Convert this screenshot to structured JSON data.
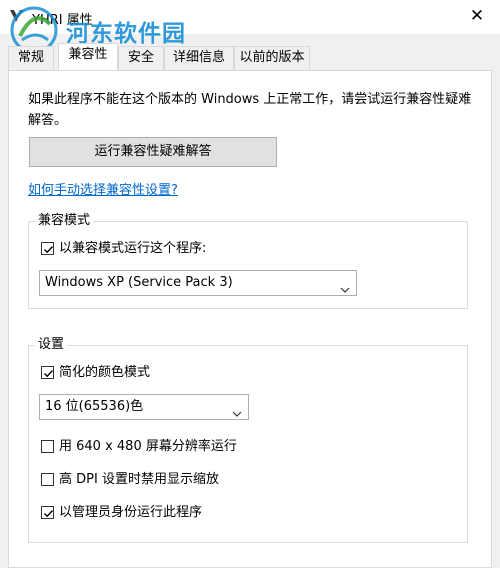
{
  "window": {
    "title": "YHRI 属性",
    "app_icon": "app-icon",
    "close_glyph": "✕"
  },
  "watermark": {
    "site": "河东软件园",
    "url_fragment": "0359"
  },
  "tabs": [
    {
      "label": "常规",
      "active": false
    },
    {
      "label": "兼容性",
      "active": true
    },
    {
      "label": "安全",
      "active": false
    },
    {
      "label": "详细信息",
      "active": false
    },
    {
      "label": "以前的版本",
      "active": false
    }
  ],
  "compat": {
    "intro": "如果此程序不能在这个版本的 Windows 上正常工作，请尝试运行兼容性疑难解答。",
    "troubleshoot_button": "运行兼容性疑难解答",
    "help_link": "如何手动选择兼容性设置?",
    "mode_group": {
      "title": "兼容模式",
      "checkbox_label": "以兼容模式运行这个程序:",
      "checked": true,
      "os_selected": "Windows XP (Service Pack 3)"
    },
    "settings_group": {
      "title": "设置",
      "reduced_color": {
        "label": "简化的颜色模式",
        "checked": true
      },
      "color_selected": "16 位(65536)色",
      "resolution": {
        "label": "用 640 x 480 屏幕分辨率运行",
        "checked": false
      },
      "dpi": {
        "label": "高 DPI 设置时禁用显示缩放",
        "checked": false
      },
      "admin": {
        "label": "以管理员身份运行此程序",
        "checked": true
      }
    }
  },
  "colors": {
    "link": "#0066cc",
    "watermark_blue": "#1a8fd6",
    "watermark_green": "#3aa935"
  }
}
